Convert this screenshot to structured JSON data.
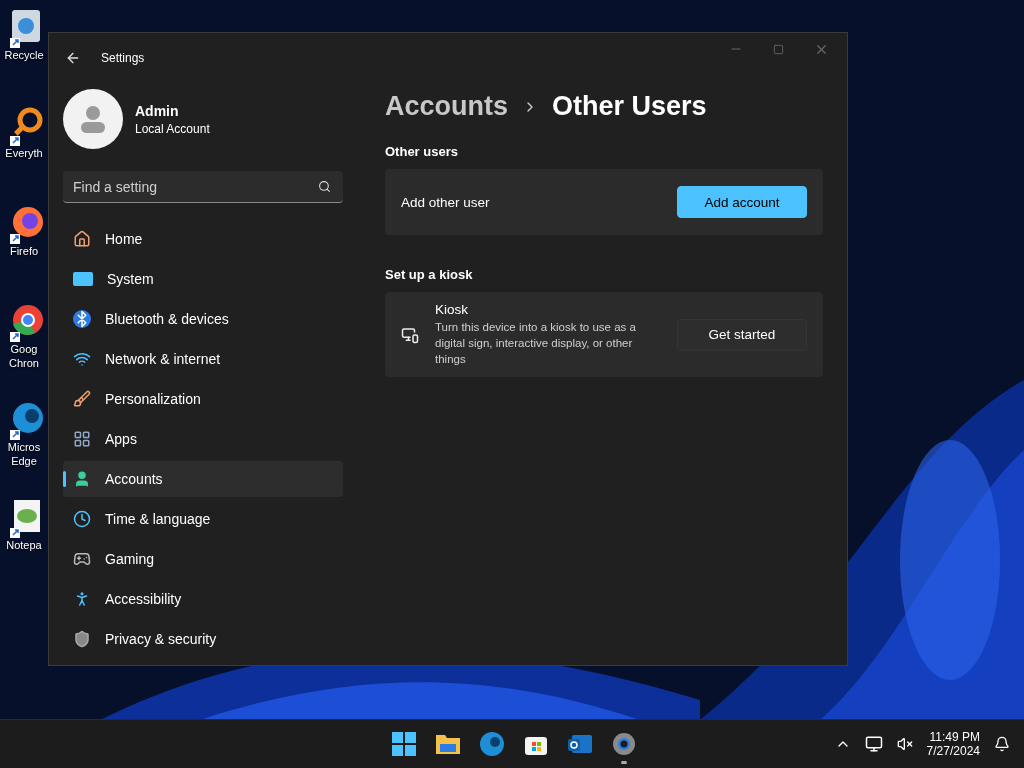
{
  "desktop_icons": [
    {
      "kind": "recycle",
      "lines": [
        "Recycle"
      ]
    },
    {
      "kind": "search",
      "lines": [
        "Everyth"
      ]
    },
    {
      "kind": "firefox",
      "lines": [
        "Firefo"
      ]
    },
    {
      "kind": "chrome",
      "lines": [
        "Goog",
        "Chron"
      ]
    },
    {
      "kind": "edge",
      "lines": [
        "Micros",
        "Edge"
      ]
    },
    {
      "kind": "notepad",
      "lines": [
        "Notepa"
      ]
    }
  ],
  "window": {
    "title": "Settings",
    "user": {
      "name": "Admin",
      "account_type": "Local Account"
    },
    "search": {
      "placeholder": "Find a setting"
    },
    "nav_items": [
      {
        "kind": "home",
        "label": "Home",
        "selected": false
      },
      {
        "kind": "system",
        "label": "System",
        "selected": false
      },
      {
        "kind": "bluetooth",
        "label": "Bluetooth & devices",
        "selected": false
      },
      {
        "kind": "network",
        "label": "Network & internet",
        "selected": false
      },
      {
        "kind": "brush",
        "label": "Personalization",
        "selected": false
      },
      {
        "kind": "apps",
        "label": "Apps",
        "selected": false
      },
      {
        "kind": "accounts",
        "label": "Accounts",
        "selected": true
      },
      {
        "kind": "time",
        "label": "Time & language",
        "selected": false
      },
      {
        "kind": "gaming",
        "label": "Gaming",
        "selected": false
      },
      {
        "kind": "accessibility",
        "label": "Accessibility",
        "selected": false
      },
      {
        "kind": "shield",
        "label": "Privacy & security",
        "selected": false
      }
    ],
    "breadcrumb": [
      "Accounts",
      "Other Users"
    ],
    "sections": [
      {
        "heading": "Other users",
        "card": {
          "kind": "simple",
          "title": "Add other user",
          "button": {
            "label": "Add account",
            "primary": true
          }
        }
      },
      {
        "heading": "Set up a kiosk",
        "card": {
          "kind": "kiosk",
          "title": "Kiosk",
          "description": "Turn this device into a kiosk to use as a digital sign, interactive display, or other things",
          "button": {
            "label": "Get started",
            "primary": false
          }
        }
      }
    ]
  },
  "taskbar": {
    "apps": [
      {
        "kind": "start",
        "active": false
      },
      {
        "kind": "folder",
        "active": false
      },
      {
        "kind": "edge",
        "active": false
      },
      {
        "kind": "store",
        "active": false
      },
      {
        "kind": "outlook",
        "active": false
      },
      {
        "kind": "settings",
        "active": true
      }
    ],
    "time": "11:49 PM",
    "date": "7/27/2024"
  }
}
